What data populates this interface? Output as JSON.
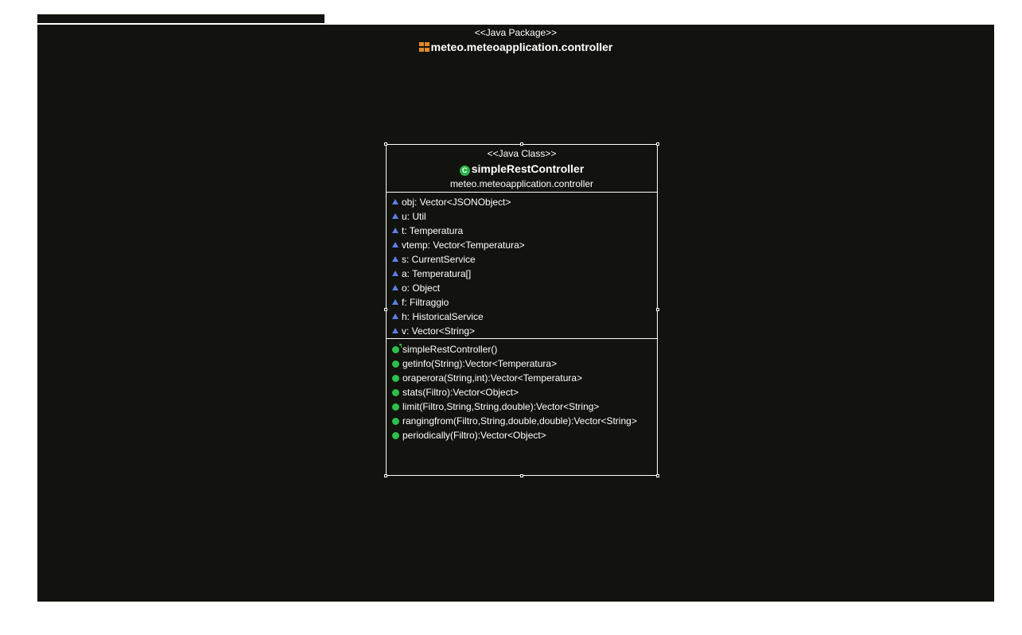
{
  "package": {
    "stereotype": "<<Java Package>>",
    "name": "meteo.meteoapplication.controller"
  },
  "class": {
    "stereotype": "<<Java Class>>",
    "name": "simpleRestController",
    "package": "meteo.meteoapplication.controller",
    "attributes": [
      "obj: Vector<JSONObject>",
      "u: Util",
      "t: Temperatura",
      "vtemp: Vector<Temperatura>",
      "s: CurrentService",
      "a: Temperatura[]",
      "o: Object",
      "f: Filtraggio",
      "h: HistoricalService",
      "v: Vector<String>"
    ],
    "operations": [
      "simpleRestController()",
      "getinfo(String):Vector<Temperatura>",
      "oraperora(String,int):Vector<Temperatura>",
      "stats(Filtro):Vector<Object>",
      "limit(Filtro,String,String,double):Vector<String>",
      "rangingfrom(Filtro,String,double,double):Vector<String>",
      "periodically(Filtro):Vector<Object>"
    ]
  },
  "colors": {
    "canvas": "#12120e",
    "class_icon": "#2cb24a",
    "method_dot": "#2cc04a",
    "attribute_triangle": "#5c80e8",
    "package_icon": "#e08a2c"
  },
  "icons": {
    "package": "package-icon",
    "class": "class-icon",
    "attribute": "package-visibility-triangle-icon",
    "method": "public-method-icon",
    "constructor": "constructor-icon"
  }
}
